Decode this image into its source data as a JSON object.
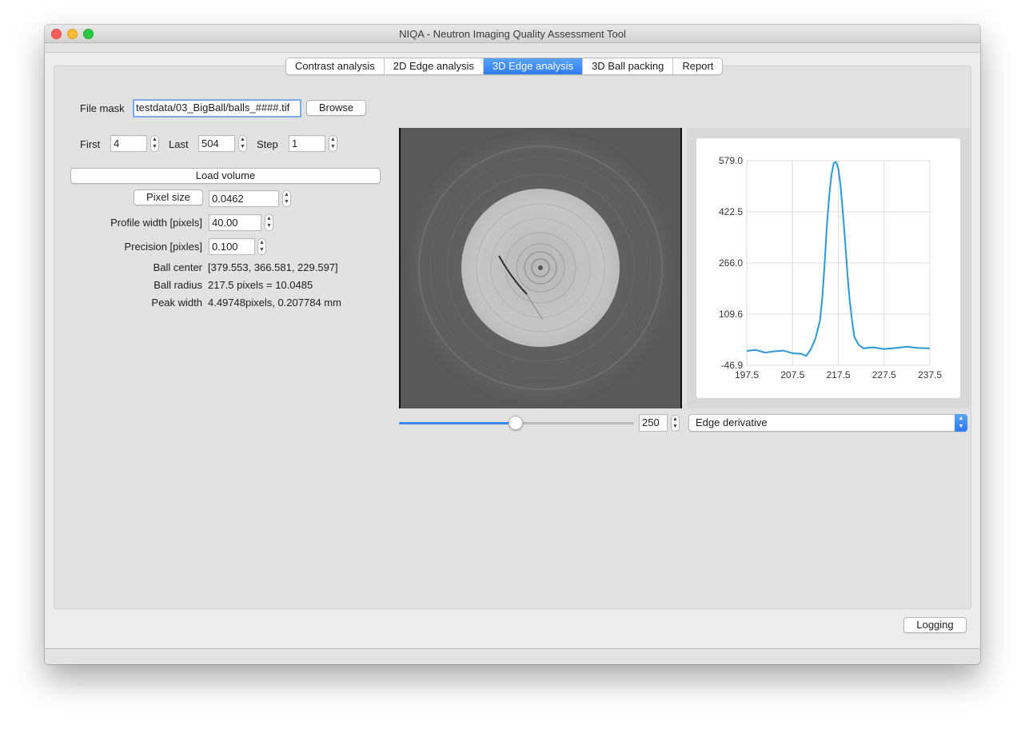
{
  "window": {
    "title": "NIQA - Neutron Imaging Quality Assessment Tool"
  },
  "tabs": [
    {
      "label": "Contrast analysis",
      "active": false
    },
    {
      "label": "2D Edge analysis",
      "active": false
    },
    {
      "label": "3D Edge analysis",
      "active": true
    },
    {
      "label": "3D Ball packing",
      "active": false
    },
    {
      "label": "Report",
      "active": false
    }
  ],
  "form": {
    "file_mask_label": "File mask",
    "file_mask_value": "testdata/03_BigBall/balls_####.tif",
    "browse_label": "Browse",
    "first_label": "First",
    "first_value": "4",
    "last_label": "Last",
    "last_value": "504",
    "step_label": "Step",
    "step_value": "1",
    "load_volume_label": "Load volume",
    "pixel_size_label": "Pixel size",
    "pixel_size_value": "0.0462",
    "profile_width_label": "Profile width [pixels]",
    "profile_width_value": "40.00",
    "precision_label": "Precision [pixles]",
    "precision_value": "0.100"
  },
  "results": {
    "ball_center_label": "Ball center",
    "ball_center_value": "[379.553, 366.581, 229.597]",
    "ball_radius_label": "Ball radius",
    "ball_radius_value": "217.5 pixels = 10.0485",
    "peak_width_label": "Peak width",
    "peak_width_value": "4.49748pixels, 0.207784 mm"
  },
  "slice": {
    "value": "250",
    "min": 0,
    "max": 504
  },
  "plot_selector": {
    "selected": "Edge derivative"
  },
  "logging_label": "Logging",
  "colors": {
    "accent": "#3b87f3",
    "series": "#2a98d8"
  },
  "chart_data": {
    "type": "line",
    "title": "",
    "xlabel": "",
    "ylabel": "",
    "xlim": [
      197.5,
      237.5
    ],
    "ylim": [
      -46.9,
      579.0
    ],
    "x_ticks": [
      "197.5",
      "207.5",
      "217.5",
      "227.5",
      "237.5"
    ],
    "y_ticks": [
      "579.0",
      "422.5",
      "266.0",
      "109.6",
      "-46.9"
    ],
    "grid": true,
    "series": [
      {
        "x": [
          197.5,
          199.5,
          201.5,
          203.5,
          205.5,
          207.5,
          209.5,
          210.5,
          211.5,
          212.5,
          213.5,
          214.0,
          214.5,
          215.0,
          215.5,
          216.0,
          216.5,
          217.0,
          217.5,
          218.0,
          218.5,
          219.0,
          219.5,
          220.0,
          220.5,
          221.0,
          222.0,
          223.0,
          225.0,
          227.5,
          230.0,
          232.5,
          235.0,
          237.5
        ],
        "y": [
          -3,
          0,
          -8,
          -4,
          -2,
          -10,
          -12,
          -18,
          2,
          35,
          90,
          160,
          260,
          380,
          470,
          535,
          572,
          575,
          555,
          500,
          420,
          330,
          230,
          150,
          90,
          40,
          15,
          5,
          8,
          3,
          6,
          10,
          6,
          5
        ]
      }
    ]
  }
}
